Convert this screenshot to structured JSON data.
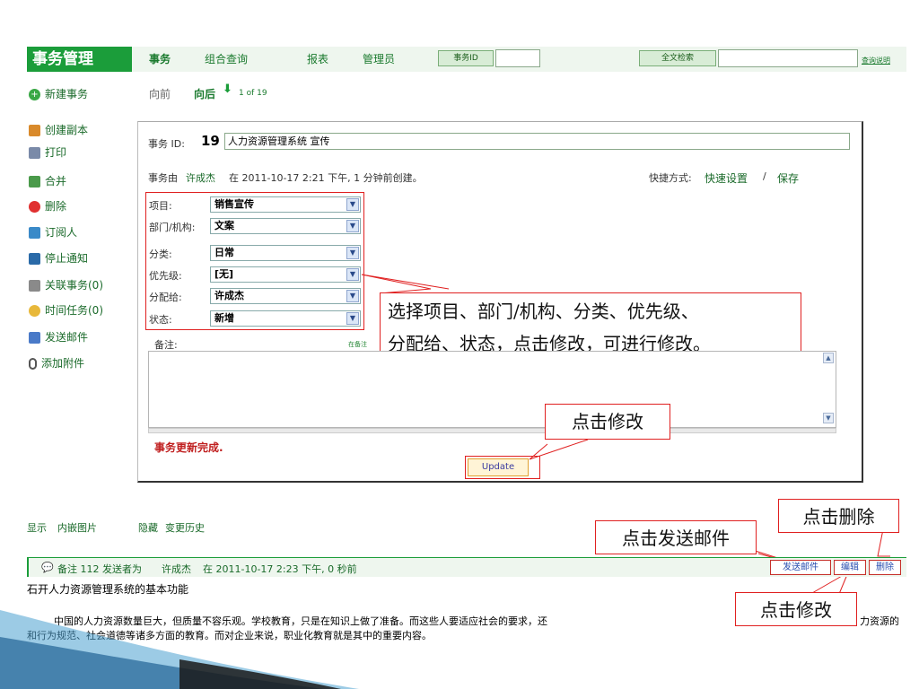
{
  "app": {
    "title": "事务管理"
  },
  "topnav": {
    "items": [
      "事务",
      "组合查询",
      "报表",
      "管理员"
    ],
    "issue_id_button": "事务ID",
    "issue_id_value": "",
    "fulltext_button": "全文检索",
    "fulltext_value": "",
    "help_link": "查询说明"
  },
  "sidebar": {
    "new_issue": "新建事务",
    "items": [
      "创建副本",
      "打印",
      "合并",
      "删除",
      "订阅人",
      "停止通知",
      "关联事务(0)",
      "时间任务(0)",
      "发送邮件",
      "添加附件"
    ]
  },
  "pager": {
    "prev": "向前",
    "next": "向后",
    "count": "1 of 19"
  },
  "issue": {
    "id_label": "事务 ID:",
    "id": "19",
    "title_value": "人力资源管理系统 宣传",
    "created_prefix": "事务由",
    "creator": "许成杰",
    "created_at": "在 2011-10-17 2:21 下午, 1 分钟前创建。",
    "shortcut_label": "快捷方式:",
    "shortcut_setup": "快速设置",
    "shortcut_sep": "/",
    "shortcut_save": "保存",
    "fields": [
      {
        "label": "项目:",
        "value": "销售宣传"
      },
      {
        "label": "部门/机构:",
        "value": "文案"
      },
      {
        "label": "分类:",
        "value": "日常"
      },
      {
        "label": "优先级:",
        "value": "[无]"
      },
      {
        "label": "分配给:",
        "value": "许成杰"
      },
      {
        "label": "状态:",
        "value": "新增"
      }
    ],
    "notes_label": "备注:",
    "notes_hint": "在备注",
    "notes_value": "",
    "update_success": "事务更新完成.",
    "update_button": "Update"
  },
  "callouts": {
    "fields_line1": "选择项目、部门/机构、分类、优先级、",
    "fields_line2": "分配给、状态，点击修改，可进行修改。",
    "update": "点击修改",
    "delete": "点击删除",
    "send_mail": "点击发送邮件",
    "edit": "点击修改"
  },
  "toggles": {
    "show": "显示",
    "inline_images": "内嵌图片",
    "hide": "隐藏",
    "history": "变更历史"
  },
  "comment": {
    "header": "备注 112 发送者为",
    "author": "许成杰",
    "time": "在 2011-10-17 2:23 下午, 0 秒前",
    "send_mail": "发送邮件",
    "edit": "编辑",
    "delete": "删除",
    "line1": "石开人力资源管理系统的基本功能",
    "line2a": "中国的人力资源数量巨大，但质量不容乐观。学校教育，只是在知识上做了准备。而这些人要适应社会的要求，还",
    "line2b": "力资源的",
    "line3": "和行为规范、社会道德等诸多方面的教育。而对企业来说，职业化教育就是其中的重要内容。"
  },
  "colors": {
    "brand": "#1b9d3a",
    "link": "#1a7a2e",
    "annotation": "#e02020"
  }
}
